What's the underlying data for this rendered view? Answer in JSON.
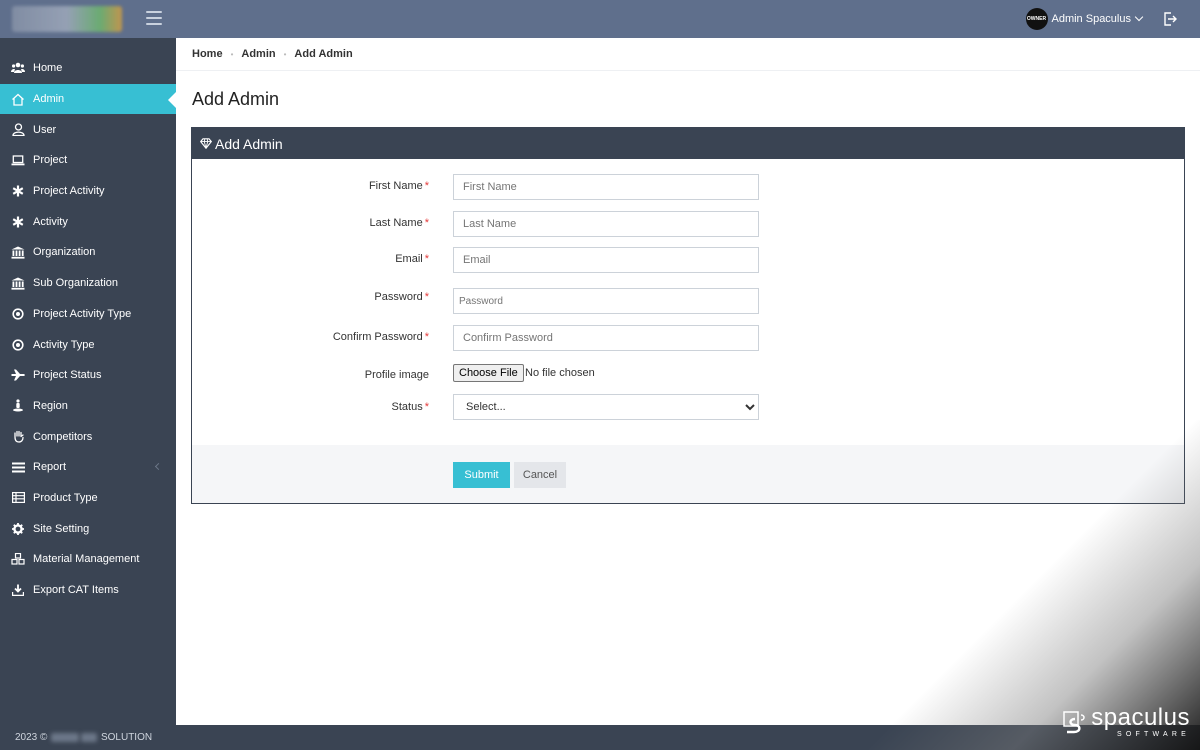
{
  "topbar": {
    "user_name": "Admin Spaculus",
    "avatar_text": "OWNER"
  },
  "sidebar": {
    "items": [
      {
        "label": "Home",
        "icon": "users-icon"
      },
      {
        "label": "Admin",
        "icon": "home-icon",
        "active": true
      },
      {
        "label": "User",
        "icon": "user-icon"
      },
      {
        "label": "Project",
        "icon": "laptop-icon"
      },
      {
        "label": "Project Activity",
        "icon": "asterisk-icon"
      },
      {
        "label": "Activity",
        "icon": "asterisk-icon"
      },
      {
        "label": "Organization",
        "icon": "institution-icon"
      },
      {
        "label": "Sub Organization",
        "icon": "institution-icon"
      },
      {
        "label": "Project Activity Type",
        "icon": "dot-circle-icon"
      },
      {
        "label": "Activity Type",
        "icon": "dot-circle-icon"
      },
      {
        "label": "Project Status",
        "icon": "plane-icon"
      },
      {
        "label": "Region",
        "icon": "street-view-icon"
      },
      {
        "label": "Competitors",
        "icon": "hand-icon"
      },
      {
        "label": "Report",
        "icon": "list-icon",
        "has_submenu": true
      },
      {
        "label": "Product Type",
        "icon": "table-list-icon"
      },
      {
        "label": "Site Setting",
        "icon": "gear-icon"
      },
      {
        "label": "Material Management",
        "icon": "cubes-icon"
      },
      {
        "label": "Export CAT Items",
        "icon": "download-icon"
      }
    ],
    "footer_year": "2023 ©",
    "footer_suffix": "SOLUTION"
  },
  "breadcrumb": [
    "Home",
    "Admin",
    "Add Admin"
  ],
  "page_title": "Add Admin",
  "card": {
    "title": "Add Admin",
    "fields": {
      "first_name": {
        "label": "First Name",
        "placeholder": "First Name",
        "value": ""
      },
      "last_name": {
        "label": "Last Name",
        "placeholder": "Last Name",
        "value": ""
      },
      "email": {
        "label": "Email",
        "placeholder": "Email",
        "value": ""
      },
      "password": {
        "label": "Password",
        "placeholder": "Password",
        "value": ""
      },
      "confirm_password": {
        "label": "Confirm Password",
        "placeholder": "Confirm Password",
        "value": ""
      },
      "profile_image": {
        "label": "Profile image",
        "button": "Choose File",
        "status": "No file chosen"
      },
      "status": {
        "label": "Status",
        "selected": "Select..."
      }
    },
    "required_mark": "*",
    "submit_label": "Submit",
    "cancel_label": "Cancel"
  },
  "watermark": {
    "title": "spaculus",
    "subtitle": "SOFTWARE"
  },
  "colors": {
    "topbar": "#5f6f8c",
    "sidebar": "#3a4453",
    "accent": "#37bfd3",
    "required": "#e43a3a"
  }
}
